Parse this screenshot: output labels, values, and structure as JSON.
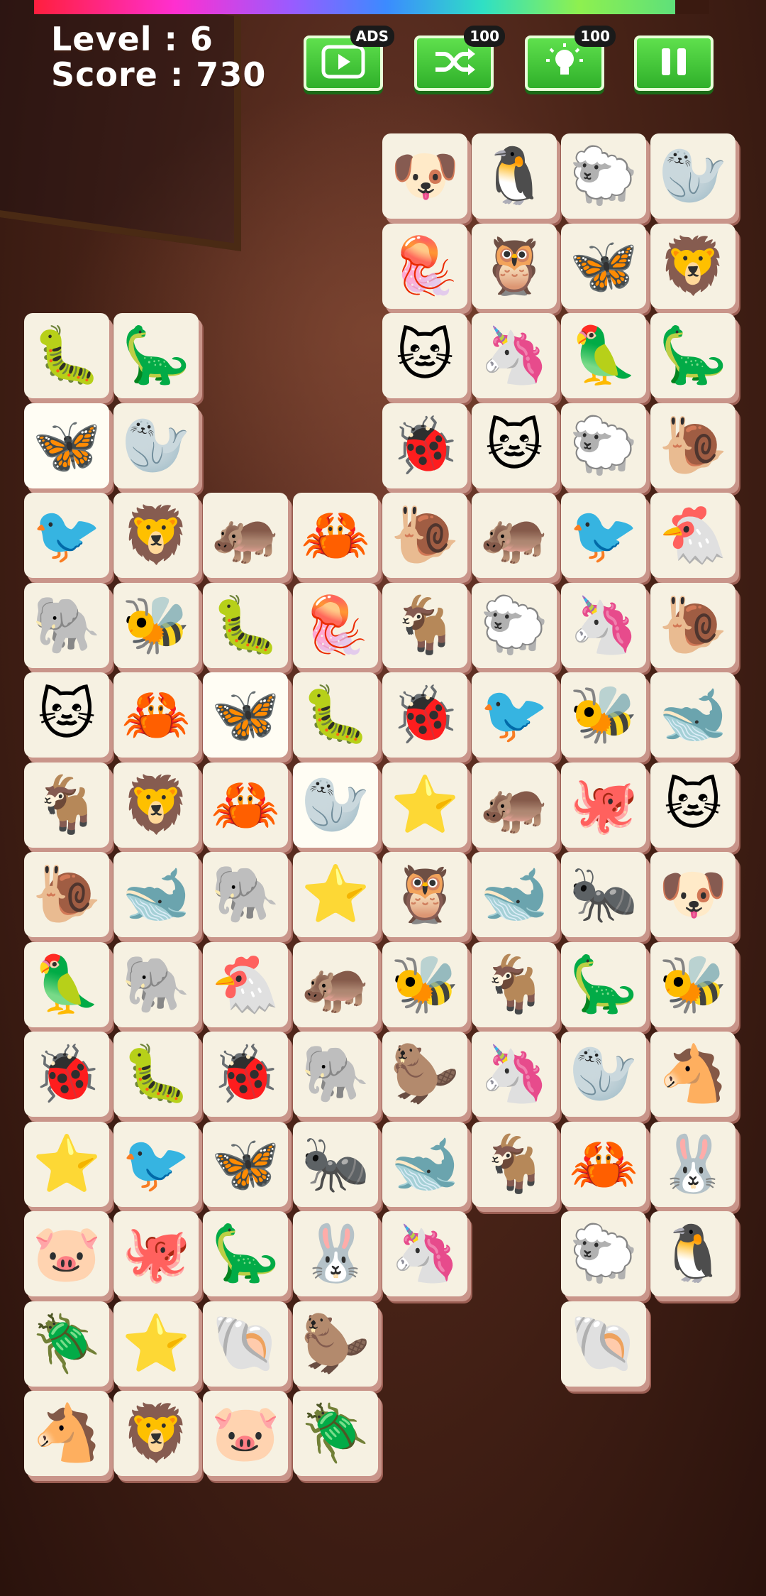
{
  "hud": {
    "level_text": "Level : 6",
    "score_text": "Score : 730",
    "timer_fraction": 0.95
  },
  "buttons": {
    "video": {
      "badge": "ADS",
      "icon": "play-icon"
    },
    "shuffle": {
      "badge": "100",
      "icon": "shuffle-icon"
    },
    "hint": {
      "badge": "100",
      "icon": "lightbulb-icon"
    },
    "pause": {
      "icon": "pause-icon"
    }
  },
  "animal_glyphs": {
    "dog": "🐶",
    "penguin": "🐧",
    "sheep": "🐑",
    "walrus": "🦭",
    "jellyfish": "🪼",
    "owl": "🦉",
    "butterfly": "🦋",
    "lion": "🦁",
    "caterpillar": "🐛",
    "dinosaur": "🦕",
    "cat": "🐱",
    "unicorn": "🦄",
    "parrot": "🦜",
    "ladybug": "🐞",
    "snail": "🐌",
    "bird": "🐦",
    "hippo": "🦛",
    "crab": "🦀",
    "chicken": "🐔",
    "elephant": "🐘",
    "bee": "🐝",
    "goat": "🐐",
    "whale": "🐋",
    "starfish": "⭐",
    "octopus": "🐙",
    "ant": "🐜",
    "beaver": "🦫",
    "seahorse": "🐴",
    "rabbit": "🐰",
    "pig": "🐷",
    "hermit-crab": "🐚",
    "beetle": "🪲"
  },
  "board": [
    [
      null,
      null,
      null,
      null,
      "dog",
      "penguin",
      "sheep",
      "walrus"
    ],
    [
      null,
      null,
      null,
      null,
      "jellyfish",
      "owl",
      "butterfly",
      "lion"
    ],
    [
      "caterpillar",
      "dinosaur",
      null,
      null,
      "cat",
      "unicorn",
      "parrot",
      "dinosaur"
    ],
    [
      "butterfly",
      "walrus",
      null,
      null,
      "ladybug",
      "cat",
      "sheep",
      "snail"
    ],
    [
      "bird",
      "lion",
      "hippo",
      "crab",
      "snail",
      "hippo",
      "bird",
      "chicken"
    ],
    [
      "elephant",
      "bee",
      "caterpillar",
      "jellyfish",
      "goat",
      "sheep",
      "unicorn",
      "snail"
    ],
    [
      "cat",
      "crab",
      "butterfly",
      "caterpillar",
      "ladybug",
      "bird",
      "bee",
      "whale"
    ],
    [
      "goat",
      "lion",
      "crab",
      "walrus",
      "starfish",
      "hippo",
      "octopus",
      "cat"
    ],
    [
      "snail",
      "whale",
      "elephant",
      "starfish",
      "owl",
      "whale",
      "ant",
      "dog"
    ],
    [
      "parrot",
      "elephant",
      "chicken",
      "hippo",
      "bee",
      "goat",
      "dinosaur",
      "bee"
    ],
    [
      "ladybug",
      "caterpillar",
      "ladybug",
      "elephant",
      "beaver",
      "unicorn",
      "walrus",
      "seahorse"
    ],
    [
      "starfish",
      "bird",
      "butterfly",
      "ant",
      "whale",
      "goat",
      "crab",
      "rabbit"
    ],
    [
      "pig",
      "octopus",
      "dinosaur",
      "rabbit",
      "unicorn",
      null,
      "sheep",
      "penguin"
    ],
    [
      "beetle",
      "starfish",
      "hermit-crab",
      "beaver",
      null,
      null,
      "hermit-crab",
      null
    ],
    [
      "seahorse",
      "lion",
      "pig",
      "beetle",
      null,
      null,
      null,
      null
    ]
  ],
  "highlighted_tiles": [
    [
      3,
      0
    ],
    [
      6,
      2
    ],
    [
      7,
      3
    ]
  ]
}
